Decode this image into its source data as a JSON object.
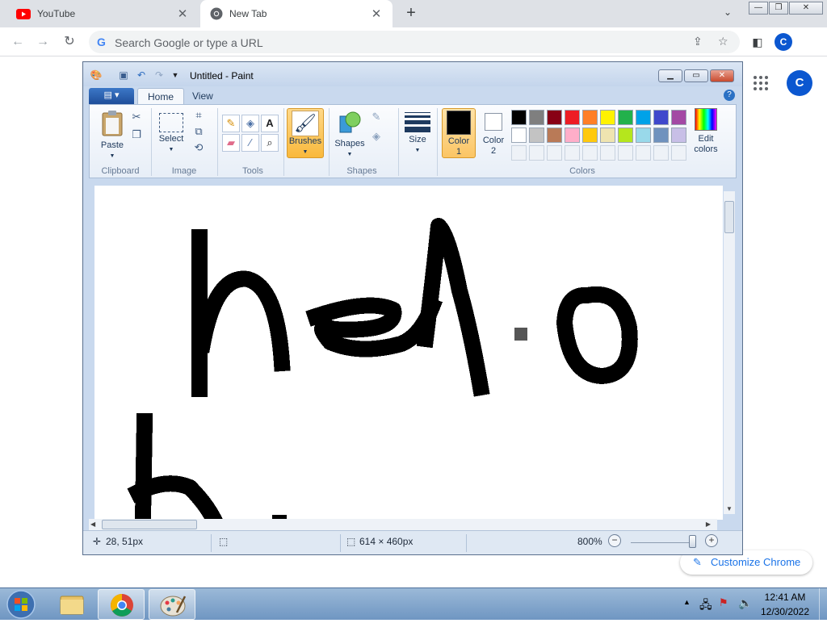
{
  "browser": {
    "tabs": [
      {
        "title": "YouTube",
        "icon": "youtube-icon",
        "active": false
      },
      {
        "title": "New Tab",
        "icon": "chrome-icon",
        "active": true
      }
    ],
    "omnibox_placeholder": "Search Google or type a URL",
    "profile_initial": "C",
    "customize_label": "Customize Chrome"
  },
  "paint": {
    "window_title": "Untitled - Paint",
    "ribbon_tabs": [
      "Home",
      "View"
    ],
    "groups": {
      "clipboard": "Clipboard",
      "image": "Image",
      "tools": "Tools",
      "shapes": "Shapes",
      "colors": "Colors"
    },
    "buttons": {
      "paste": "Paste",
      "select": "Select",
      "brushes": "Brushes",
      "shapes": "Shapes",
      "size": "Size",
      "color1": "Color\n1",
      "color1_a": "Color",
      "color1_b": "1",
      "color2_a": "Color",
      "color2_b": "2",
      "edit_colors_a": "Edit",
      "edit_colors_b": "colors"
    },
    "color1_value": "#000000",
    "color2_value": "#ffffff",
    "palette_row1": [
      "#000000",
      "#7f7f7f",
      "#880015",
      "#ed1c24",
      "#ff7f27",
      "#fff200",
      "#22b14c",
      "#00a2e8",
      "#3f48cc",
      "#a349a4"
    ],
    "palette_row2": [
      "#ffffff",
      "#c3c3c3",
      "#b97a57",
      "#ffaec9",
      "#ffc90e",
      "#efe4b0",
      "#b5e61d",
      "#99d9ea",
      "#7092be",
      "#c8bfe7"
    ],
    "status": {
      "cursor_pos": "28, 51px",
      "canvas_size": "614 × 460px",
      "zoom": "800%"
    },
    "canvas_drawing": "hello"
  },
  "taskbar": {
    "time": "12:41 AM",
    "date": "12/30/2022"
  }
}
